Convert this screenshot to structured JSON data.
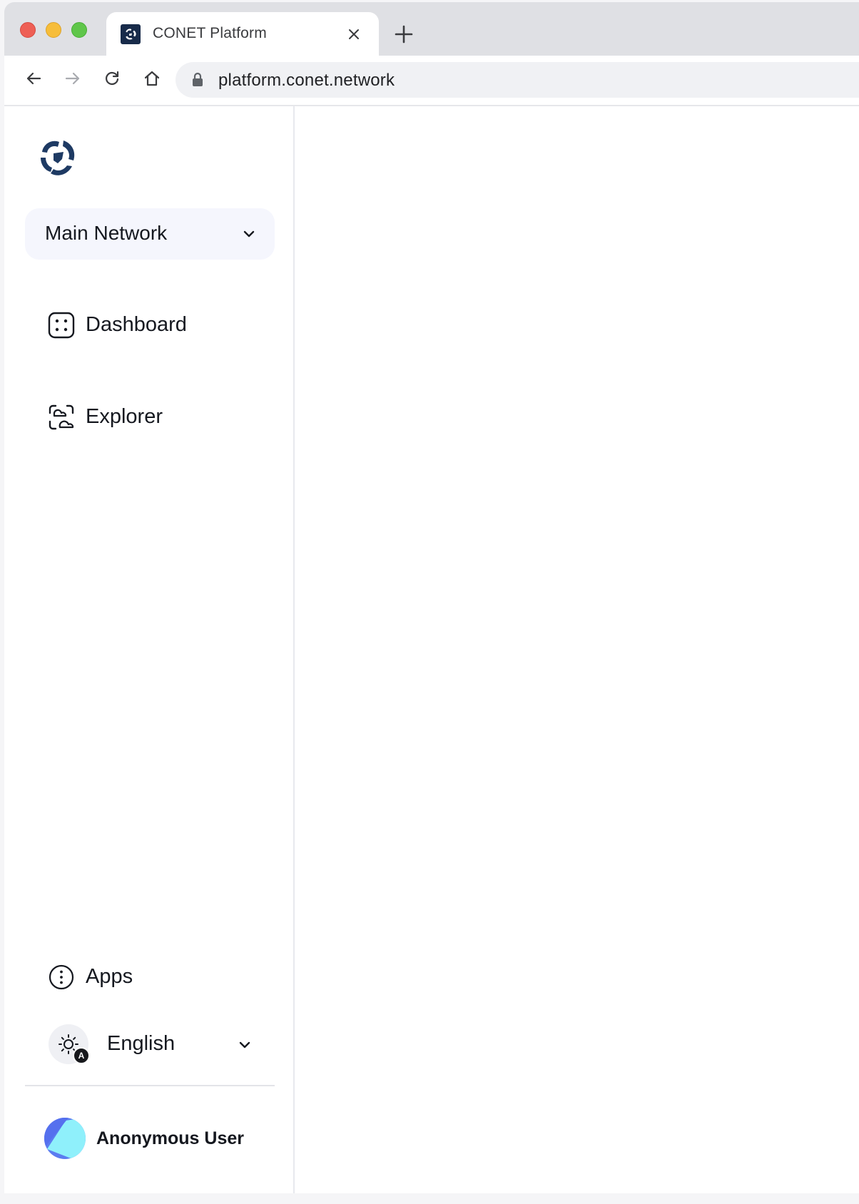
{
  "browser": {
    "tab": {
      "title": "CONET Platform",
      "favicon": "conet-logo-icon"
    },
    "toolbar": {
      "url": "platform.conet.network",
      "icons": [
        "back-arrow-icon",
        "forward-arrow-icon",
        "reload-icon",
        "home-icon",
        "lock-icon"
      ]
    },
    "colors": {
      "close": "#ee5f55",
      "minimize": "#f6bd3a",
      "maximize": "#5fc64a"
    }
  },
  "sidebar": {
    "logo": "conet-logo-icon",
    "network_select": {
      "selected": "Main Network",
      "icon": "chevron-down-icon"
    },
    "nav": [
      {
        "label": "Dashboard",
        "icon": "dashboard-icon"
      },
      {
        "label": "Explorer",
        "icon": "explorer-icon"
      }
    ],
    "apps": {
      "label": "Apps",
      "icon": "more-vertical-icon"
    },
    "theme": {
      "icon": "sun-icon",
      "badge": "A"
    },
    "language": {
      "selected": "English",
      "icon": "chevron-down-icon"
    },
    "user": {
      "name": "Anonymous User",
      "avatar": "avatar-icon"
    }
  },
  "theme_colors": {
    "brand": "#1e3a63",
    "network_select_bg": "#f5f6fd",
    "text": "#15181f"
  }
}
